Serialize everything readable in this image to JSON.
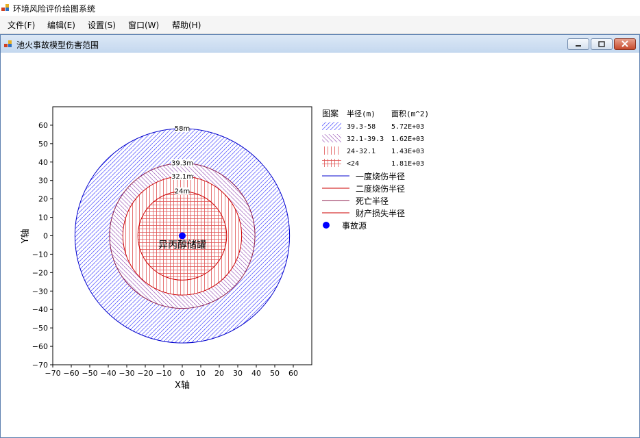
{
  "app": {
    "title": "环境风险评价绘图系统"
  },
  "menu": [
    {
      "label": "文件(F)"
    },
    {
      "label": "编辑(E)"
    },
    {
      "label": "设置(S)"
    },
    {
      "label": "窗口(W)"
    },
    {
      "label": "帮助(H)"
    }
  ],
  "child_window": {
    "title": "池火事故模型伤害范围"
  },
  "icons": {
    "app": "app-icon",
    "child": "child-window-icon",
    "minimize": "minimize-icon",
    "restore": "restore-icon",
    "close": "close-icon"
  },
  "colors": {
    "blue": "#0000cc",
    "red": "#cc0000",
    "purple": "#8b1a4a",
    "hatch_blue": "#6a6aff",
    "hatch_red": "#e05050",
    "dot": "#0000ff"
  },
  "chart_data": {
    "type": "scatter",
    "xlabel": "X轴",
    "ylabel": "Y轴",
    "xlim": [
      -70,
      70
    ],
    "ylim": [
      -70,
      70
    ],
    "xticks": [
      -70,
      -60,
      -50,
      -40,
      -30,
      -20,
      -10,
      0,
      10,
      20,
      30,
      40,
      50,
      60
    ],
    "yticks": [
      60,
      50,
      40,
      30,
      20,
      10,
      0,
      -10,
      -20,
      -30,
      -40,
      -50,
      -60,
      -70
    ],
    "grid": false,
    "circles": [
      {
        "radius": 58,
        "label": "58m"
      },
      {
        "radius": 39.3,
        "label": "39.3m"
      },
      {
        "radius": 32.1,
        "label": "32.1m"
      },
      {
        "radius": 24,
        "label": "24m"
      }
    ],
    "source": {
      "x": 0,
      "y": 0,
      "label": "异丙醇储罐"
    },
    "legend_header": {
      "pattern": "图案",
      "radius": "半径(m)",
      "area": "面积(m^2)"
    },
    "legend_zones": [
      {
        "range": "39.3-58",
        "area": "5.72E+03"
      },
      {
        "range": "32.1-39.3",
        "area": "1.62E+03"
      },
      {
        "range": "24-32.1",
        "area": "1.43E+03"
      },
      {
        "range": "<24",
        "area": "1.81E+03"
      }
    ],
    "legend_lines": [
      {
        "name": "一度烧伤半径"
      },
      {
        "name": "二度烧伤半径"
      },
      {
        "name": "死亡半径"
      },
      {
        "name": "财产损失半径"
      },
      {
        "name": "事故源"
      }
    ],
    "legend_position": "right"
  }
}
